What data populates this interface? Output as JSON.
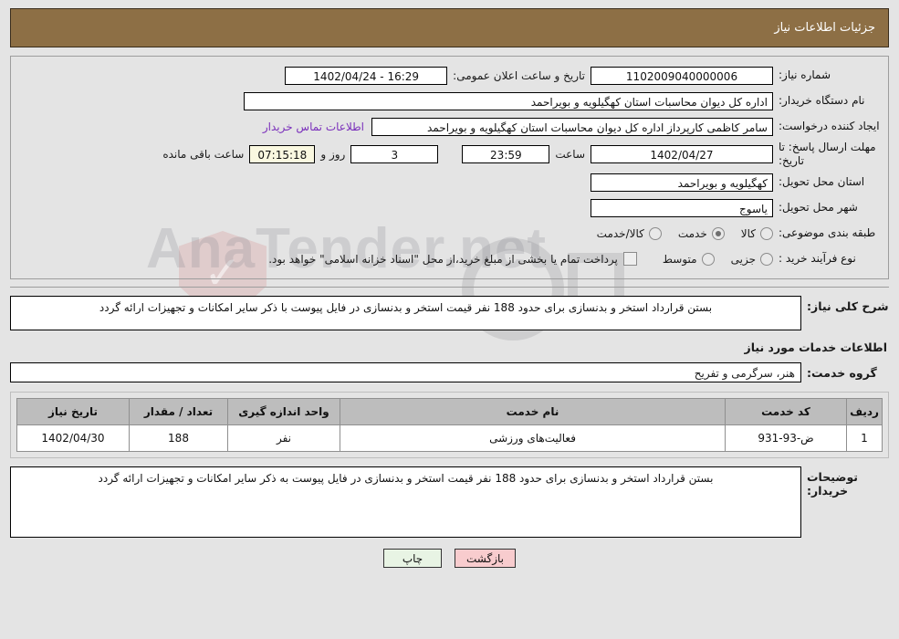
{
  "header": {
    "title": "جزئیات اطلاعات نیاز"
  },
  "watermark": {
    "text": "AnaTender.net"
  },
  "form": {
    "need_number": {
      "label": "شماره نیاز:",
      "value": "1102009040000006"
    },
    "announce": {
      "label": "تاریخ و ساعت اعلان عمومی:",
      "value": "16:29 - 1402/04/24"
    },
    "buyer_org": {
      "label": "نام دستگاه خریدار:",
      "value": "اداره کل دیوان محاسبات استان کهگیلویه و بویراحمد"
    },
    "creator": {
      "label": "ایجاد کننده درخواست:",
      "value": "سامر کاظمی کارپرداز اداره کل دیوان محاسبات استان کهگیلویه و بویراحمد"
    },
    "contact_link": "اطلاعات تماس خریدار",
    "deadline": {
      "label": "مهلت ارسال پاسخ: تا تاریخ:",
      "date": "1402/04/27",
      "time_label": "ساعت",
      "time": "23:59",
      "days": "3",
      "days_label": "روز و",
      "hours": "07:15:18",
      "hours_label": "ساعت باقی مانده"
    },
    "province": {
      "label": "استان محل تحویل:",
      "value": "کهگیلویه و بویراحمد"
    },
    "city": {
      "label": "شهر محل تحویل:",
      "value": "یاسوج"
    },
    "subject_class": {
      "label": "طبقه بندی موضوعی:",
      "options": [
        {
          "label": "کالا",
          "selected": false
        },
        {
          "label": "خدمت",
          "selected": true
        },
        {
          "label": "کالا/خدمت",
          "selected": false
        }
      ]
    },
    "process_type": {
      "label": "نوع فرآیند خرید :",
      "options": [
        {
          "label": "جزیی",
          "selected": false
        },
        {
          "label": "متوسط",
          "selected": false
        }
      ],
      "checkbox": {
        "checked": false,
        "text": "پرداخت تمام یا بخشی از مبلغ خرید،از محل \"اسناد خزانه اسلامی\" خواهد بود."
      }
    }
  },
  "description": {
    "label": "شرح کلی نیاز:",
    "value": "بستن قرارداد استخر و بدنسازی برای حدود 188 نفر قیمت استخر و بدنسازی در فایل پیوست با ذکر سایر امکانات و تجهیزات ارائه گردد"
  },
  "services_section": {
    "title": "اطلاعات خدمات مورد نیاز",
    "group": {
      "label": "گروه خدمت:",
      "value": "هنر، سرگرمی و تفریح"
    }
  },
  "table": {
    "columns": [
      "ردیف",
      "کد خدمت",
      "نام خدمت",
      "واحد اندازه گیری",
      "تعداد / مقدار",
      "تاریخ نیاز"
    ],
    "rows": [
      {
        "radif": "1",
        "code": "ض-93-931",
        "name": "فعالیت‌های ورزشی",
        "unit": "نفر",
        "qty": "188",
        "date": "1402/04/30"
      }
    ]
  },
  "buyer_notes": {
    "label": "توضیحات خریدار:",
    "value": "بستن قرارداد استخر و بدنسازی برای حدود 188 نفر قیمت استخر و بدنسازی در فایل پیوست به ذکر سایر امکانات و تجهیزات ارائه گردد"
  },
  "buttons": {
    "print": "چاپ",
    "back": "بازگشت"
  },
  "colors": {
    "header_bg": "#8d6f45",
    "link": "#7a2fbb",
    "countdown_bg": "#faf8e0",
    "print_bg": "#e8f4e4",
    "back_bg": "#f8ccce",
    "table_header_bg": "#bdbdbd",
    "page_bg": "#e4e4e4"
  }
}
